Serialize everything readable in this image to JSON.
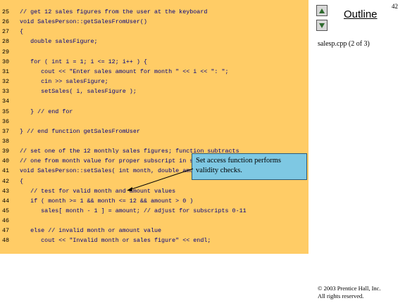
{
  "slide_number": "42",
  "outline": {
    "title": "Outline",
    "file_label": "salesp.cpp (2 of 3)"
  },
  "code_lines": [
    {
      "num": "25",
      "text": "// get 12 sales figures from the user at the keyboard"
    },
    {
      "num": "26",
      "text": "void SalesPerson::getSalesFromUser()"
    },
    {
      "num": "27",
      "text": "{"
    },
    {
      "num": "28",
      "text": "   double salesFigure;"
    },
    {
      "num": "29",
      "text": ""
    },
    {
      "num": "30",
      "text": "   for ( int i = 1; i <= 12; i++ ) {"
    },
    {
      "num": "31",
      "text": "      cout << \"Enter sales amount for month \" << i << \": \";"
    },
    {
      "num": "32",
      "text": "      cin >> salesFigure;"
    },
    {
      "num": "33",
      "text": "      setSales( i, salesFigure );"
    },
    {
      "num": "34",
      "text": ""
    },
    {
      "num": "35",
      "text": "   } // end for"
    },
    {
      "num": "36",
      "text": ""
    },
    {
      "num": "37",
      "text": "} // end function getSalesFromUser"
    },
    {
      "num": "38",
      "text": ""
    },
    {
      "num": "39",
      "text": "// set one of the 12 monthly sales figures; function subtracts"
    },
    {
      "num": "40",
      "text": "// one from month value for proper subscript in sales array"
    },
    {
      "num": "41",
      "text": "void SalesPerson::setSales( int month, double amount )"
    },
    {
      "num": "42",
      "text": "{"
    },
    {
      "num": "43",
      "text": "   // test for valid month and amount values"
    },
    {
      "num": "44",
      "text": "   if ( month >= 1 && month <= 12 && amount > 0 )"
    },
    {
      "num": "45",
      "text": "      sales[ month - 1 ] = amount; // adjust for subscripts 0-11"
    },
    {
      "num": "46",
      "text": ""
    },
    {
      "num": "47",
      "text": "   else // invalid month or amount value"
    },
    {
      "num": "48",
      "text": "      cout << \"Invalid month or sales figure\" << endl;"
    }
  ],
  "callout": {
    "line1": "Set access function performs",
    "line2": "validity checks."
  },
  "copyright": {
    "line1": "© 2003 Prentice Hall, Inc.",
    "line2": "All rights reserved."
  },
  "colors": {
    "code_background": "#ffcc66",
    "code_text": "#000080",
    "callout_background": "#7ec8e3"
  },
  "icons": {
    "prev": "triangle-up-icon",
    "next": "triangle-down-icon"
  }
}
